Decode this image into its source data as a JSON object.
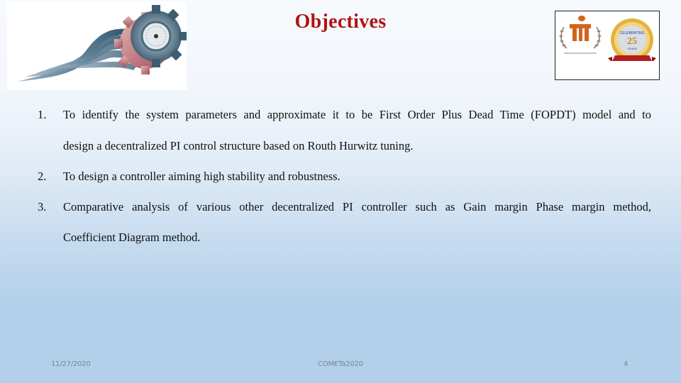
{
  "slide": {
    "title": "Objectives",
    "logos": {
      "left": "conference-gear-logo",
      "right": [
        "manipal-university-logo",
        "silver-jubilee-emblem"
      ]
    },
    "objectives": [
      {
        "number": "1.",
        "lines": [
          "To identify the system parameters and approximate it to be First Order Plus Dead Time (FOPDT) model and to",
          "design a decentralized PI control structure based on Routh Hurwitz tuning."
        ]
      },
      {
        "number": "2.",
        "lines": [
          "To design a controller aiming high stability and robustness."
        ]
      },
      {
        "number": "3.",
        "lines": [
          "Comparative analysis of various other decentralized PI controller such as Gain margin Phase margin method,",
          "Coefficient Diagram method."
        ]
      }
    ],
    "footer": {
      "date": "11/27/2020",
      "center": "COMETa2020",
      "page_number": "4"
    },
    "colors": {
      "title": "#b01212",
      "body_text": "#111111",
      "footer_text": "#7a8797",
      "background_top": "#f7fafd",
      "background_bottom": "#b3d0ea"
    }
  }
}
